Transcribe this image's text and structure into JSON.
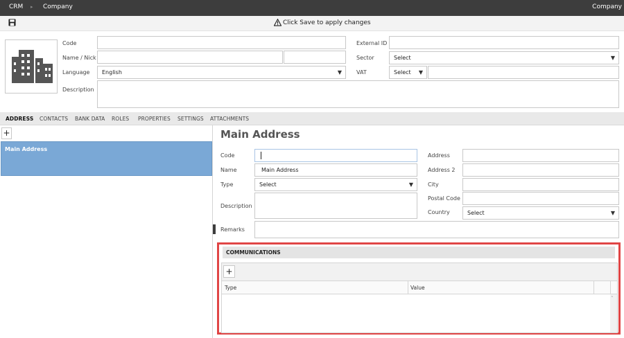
{
  "topbar": {
    "app": "CRM",
    "section": "Company",
    "right": "Company"
  },
  "toolbar": {
    "save_icon": "save-icon",
    "warning_icon": "warning-icon",
    "message": "Click Save to apply changes"
  },
  "header": {
    "logo_icon": "building-icon",
    "code_label": "Code",
    "code_value": "",
    "name_label": "Name / Nick",
    "name_value": "",
    "nick_value": "",
    "language_label": "Language",
    "language_value": "English",
    "description_label": "Description",
    "description_value": "",
    "external_id_label": "External ID",
    "external_id_value": "",
    "sector_label": "Sector",
    "sector_value": "Select",
    "vat_label": "VAT",
    "vat_type_value": "Select",
    "vat_value": ""
  },
  "tabs": [
    {
      "label": "ADDRESS",
      "active": true
    },
    {
      "label": "CONTACTS"
    },
    {
      "label": "BANK DATA"
    },
    {
      "label": "ROLES"
    },
    {
      "label": "PROPERTIES"
    },
    {
      "label": "SETTINGS"
    },
    {
      "label": "ATTACHMENTS"
    }
  ],
  "left": {
    "add_label": "+",
    "items": [
      {
        "label": "Main Address",
        "selected": true
      }
    ]
  },
  "address": {
    "title": "Main Address",
    "code_label": "Code",
    "code_value": "",
    "name_label": "Name",
    "name_value": "Main Address",
    "type_label": "Type",
    "type_value": "Select",
    "description_label": "Description",
    "description_value": "",
    "remarks_label": "Remarks",
    "remarks_value": "",
    "address_label": "Address",
    "address_value": "",
    "address2_label": "Address 2",
    "address2_value": "",
    "city_label": "City",
    "city_value": "",
    "postal_label": "Postal Code",
    "postal_value": "",
    "country_label": "Country",
    "country_value": "Select"
  },
  "communications": {
    "title": "COMMUNICATIONS",
    "add_label": "+",
    "columns": [
      "Type",
      "Value"
    ],
    "rows": []
  },
  "colors": {
    "topbar": "#3d3d3d",
    "selected_item": "#7aa8d6",
    "highlight": "#e04545"
  }
}
